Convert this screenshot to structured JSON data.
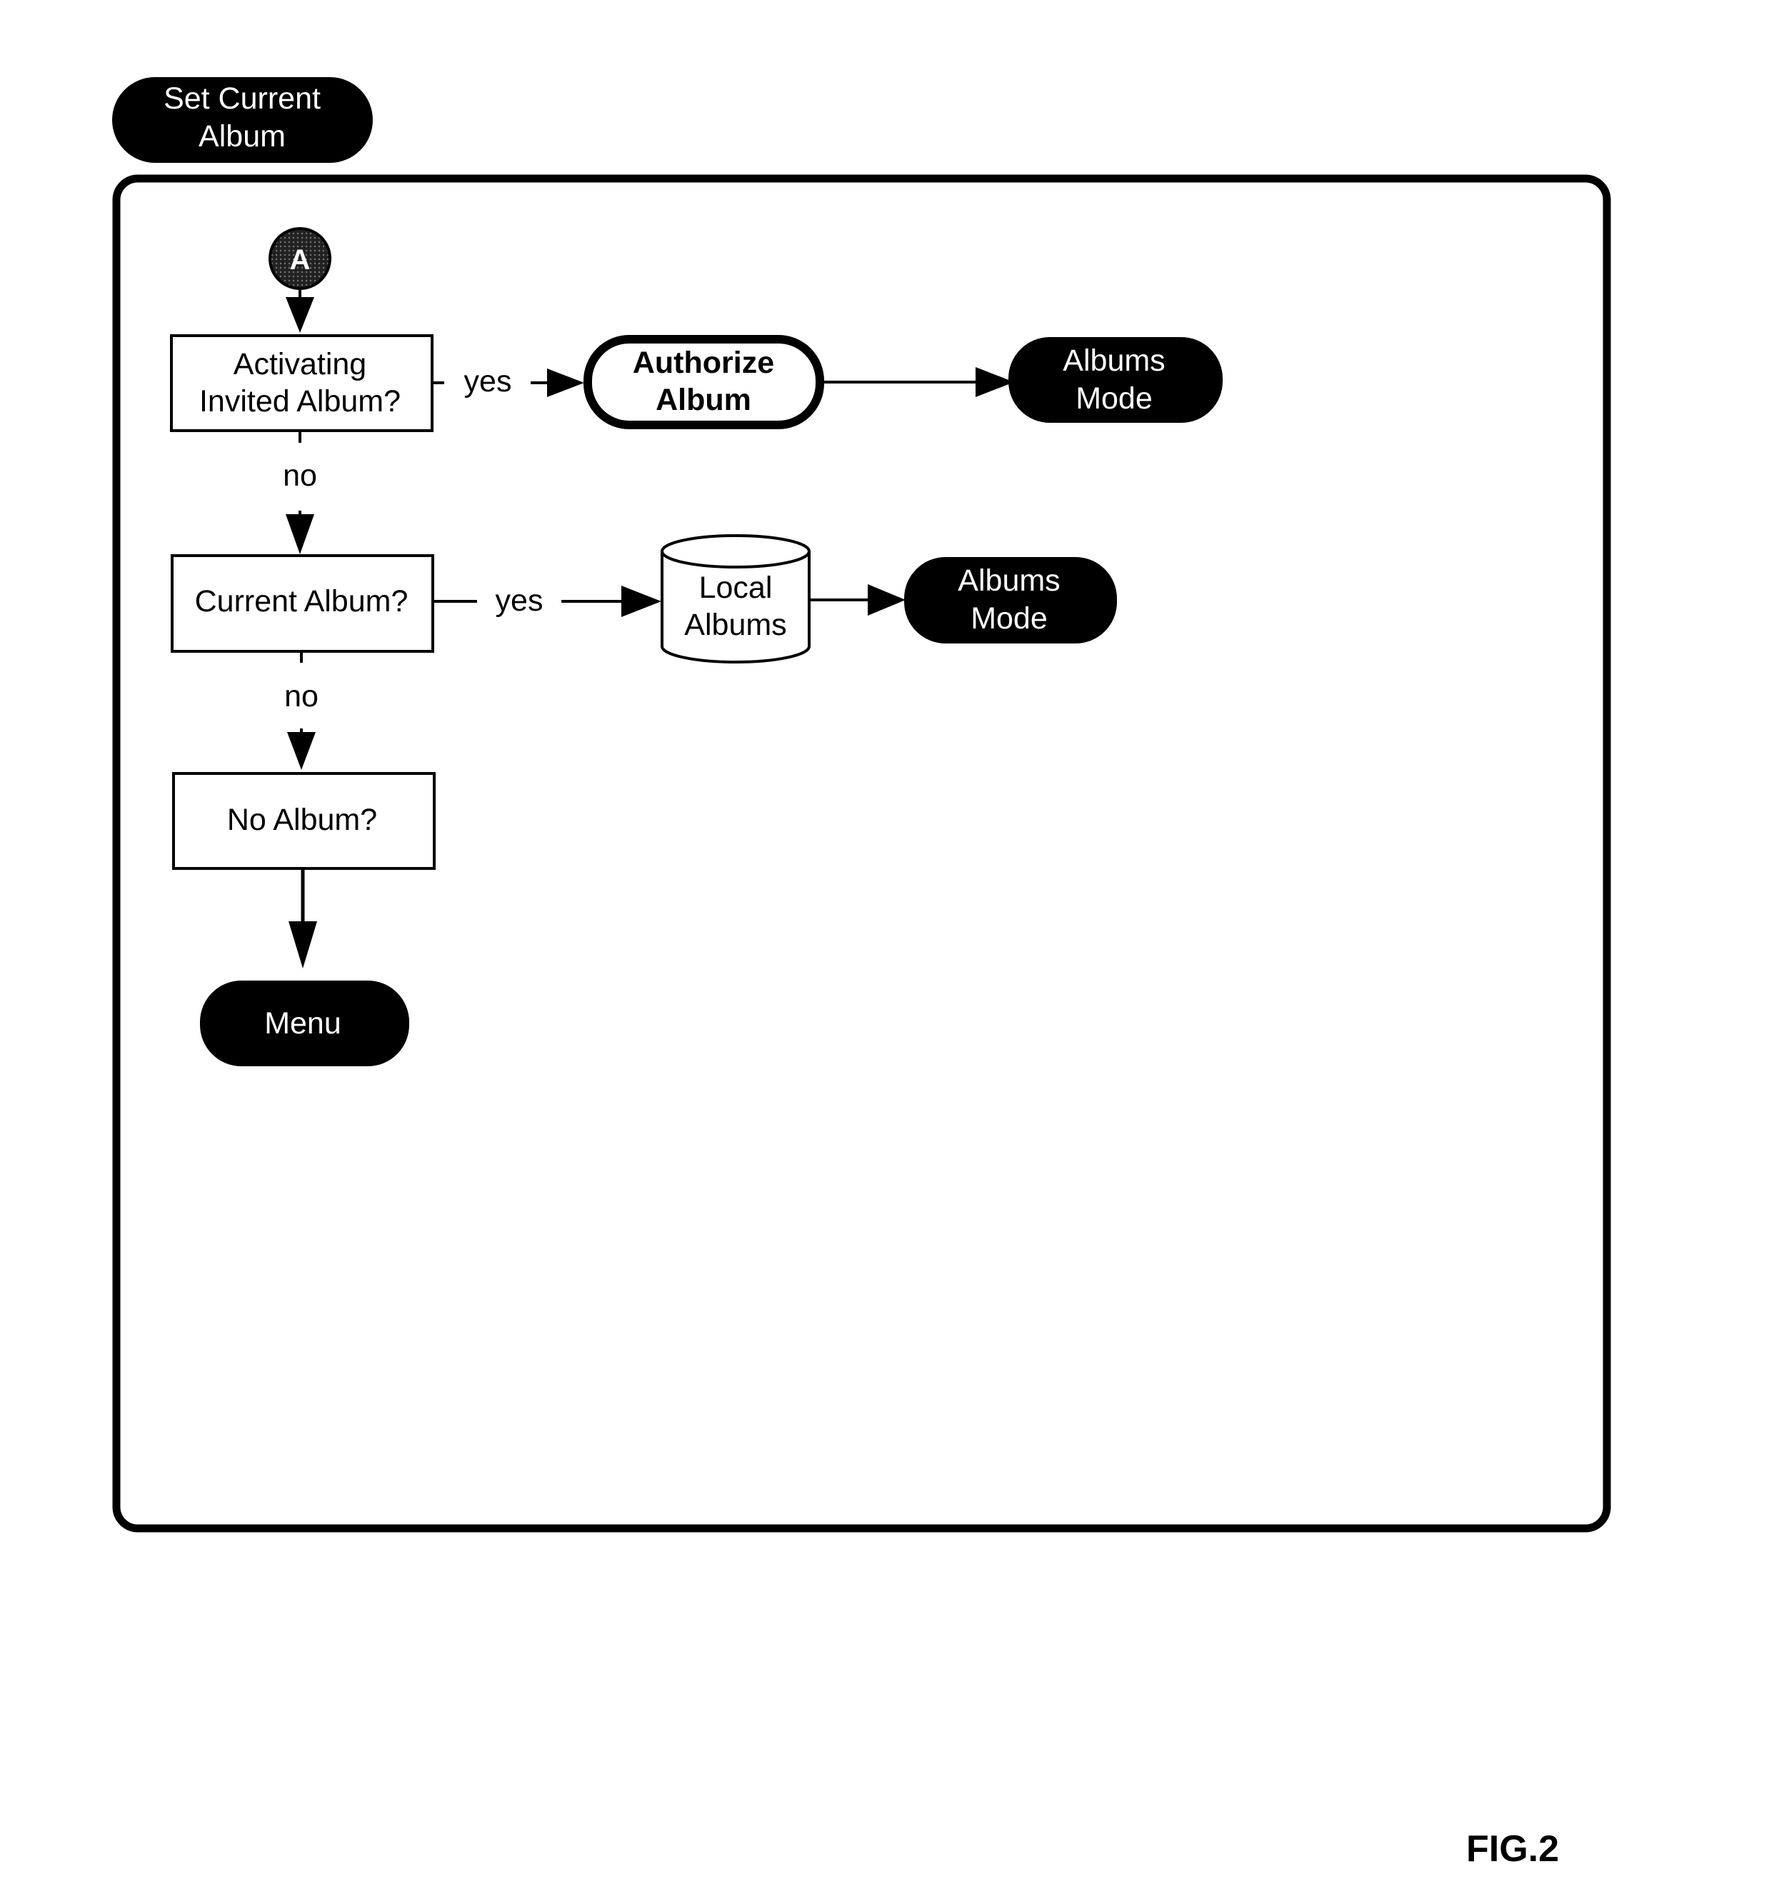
{
  "title_pill": {
    "line1": "Set Current",
    "line2": "Album"
  },
  "connector": {
    "label": "A",
    "icon": "connector-circle-icon"
  },
  "nodes": {
    "activating_invited": {
      "line1": "Activating",
      "line2": "Invited Album?"
    },
    "authorize_album": {
      "line1": "Authorize",
      "line2": "Album"
    },
    "albums_mode_1": {
      "line1": "Albums",
      "line2": "Mode"
    },
    "current_album": {
      "label": "Current Album?"
    },
    "local_albums": {
      "line1": "Local",
      "line2": "Albums"
    },
    "albums_mode_2": {
      "line1": "Albums",
      "line2": "Mode"
    },
    "no_album": {
      "label": "No Album?"
    },
    "menu": {
      "label": "Menu"
    }
  },
  "edges": {
    "yes_1": "yes",
    "no_1": "no",
    "yes_2": "yes",
    "no_2": "no"
  },
  "figure_label": "FIG.2",
  "colors": {
    "ink": "#000000",
    "paper": "#ffffff"
  }
}
